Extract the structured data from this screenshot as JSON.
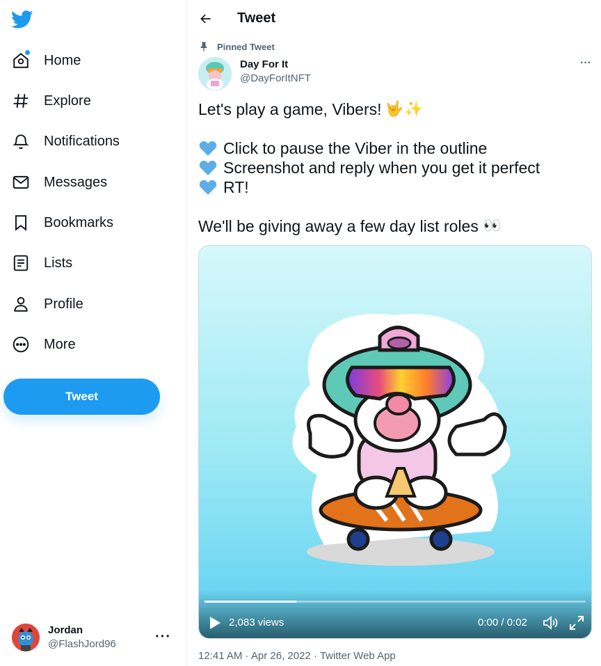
{
  "colors": {
    "accent": "#1d9bf0",
    "text_primary": "#0f1419",
    "text_secondary": "#536471",
    "heart_blue": "#5daee6"
  },
  "sidebar": {
    "logo_icon": "twitter-bird-icon",
    "items": [
      {
        "label": "Home",
        "icon": "home-icon",
        "has_notification_dot": true
      },
      {
        "label": "Explore",
        "icon": "hashtag-icon"
      },
      {
        "label": "Notifications",
        "icon": "bell-icon"
      },
      {
        "label": "Messages",
        "icon": "envelope-icon"
      },
      {
        "label": "Bookmarks",
        "icon": "bookmark-icon"
      },
      {
        "label": "Lists",
        "icon": "list-icon"
      },
      {
        "label": "Profile",
        "icon": "person-icon"
      },
      {
        "label": "More",
        "icon": "more-circle-icon"
      }
    ],
    "tweet_button_label": "Tweet",
    "account": {
      "name": "Jordan",
      "handle": "@FlashJord96",
      "more_icon": "ellipsis-icon"
    }
  },
  "header": {
    "back_icon": "arrow-left-icon",
    "title": "Tweet"
  },
  "tweet": {
    "pinned_label": "Pinned Tweet",
    "pinned_icon": "pin-icon",
    "author_name": "Day For It",
    "author_handle": "@DayForItNFT",
    "more_icon": "ellipsis-icon",
    "text": {
      "line1": "Let's play a game, Vibers!",
      "line1_emojis": [
        "🤟",
        "✨"
      ],
      "bullets": [
        "Click to pause the Viber in the outline",
        "Screenshot and reply when you get it perfect",
        "RT!"
      ],
      "bullet_icon": "blue-heart-emoji",
      "line_last": "We'll be giving away a few day list roles",
      "line_last_emoji": "👀"
    },
    "video": {
      "views": "2,083 views",
      "time": "0:00 / 0:02",
      "progress": 0.24,
      "play_icon": "play-icon",
      "volume_icon": "volume-icon",
      "fullscreen_icon": "fullscreen-icon"
    },
    "meta": "12:41 AM · Apr 26, 2022 · Twitter Web App"
  }
}
